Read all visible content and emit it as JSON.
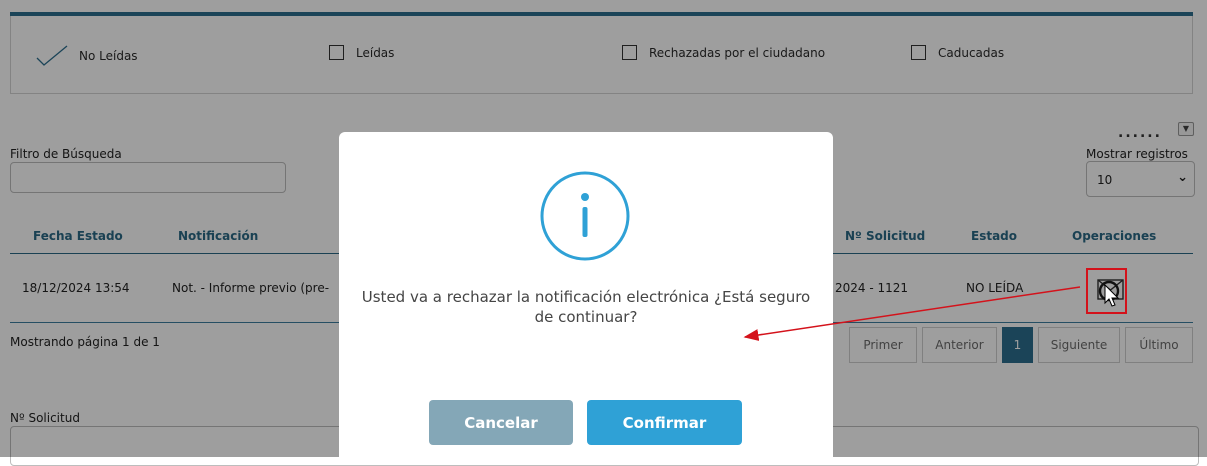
{
  "filters": {
    "unread": "No Leídas",
    "read": "Leídas",
    "rejected": "Rechazadas por el ciudadano",
    "expired": "Caducadas"
  },
  "search": {
    "label": "Filtro de Búsqueda",
    "value": ""
  },
  "records": {
    "dots": "......",
    "label": "Mostrar registros",
    "selected": "10"
  },
  "table": {
    "headers": {
      "fecha": "Fecha Estado",
      "notificacion": "Notificación",
      "solicitud": "Nº Solicitud",
      "estado": "Estado",
      "operaciones": "Operaciones"
    },
    "row": {
      "fecha": "18/12/2024 13:54",
      "notificacion": "Not. - Informe previo (pre-",
      "solicitud": "2024 - 1121",
      "estado": "NO LEÍDA"
    }
  },
  "pagination": {
    "info": "Mostrando página 1 de 1",
    "first": "Primer",
    "prev": "Anterior",
    "page": "1",
    "next": "Siguiente",
    "last": "Último"
  },
  "solicitud_field": {
    "label": "Nº Solicitud",
    "value": ""
  },
  "modal": {
    "message": "Usted va a rechazar la notificación electrónica ¿Está seguro de continuar?",
    "cancel": "Cancelar",
    "confirm": "Confirmar"
  },
  "colors": {
    "accent": "#2d6f8f",
    "confirm_button": "#2fa1d6",
    "cancel_button": "#84a7b7",
    "info_icon": "#2fa1d6",
    "annotation": "#d4121b"
  },
  "icons": {
    "modal": "info-circle-icon",
    "reject": "reject-circle-icon",
    "mail": "envelope-icon",
    "unread_check": "checkmark-icon"
  }
}
